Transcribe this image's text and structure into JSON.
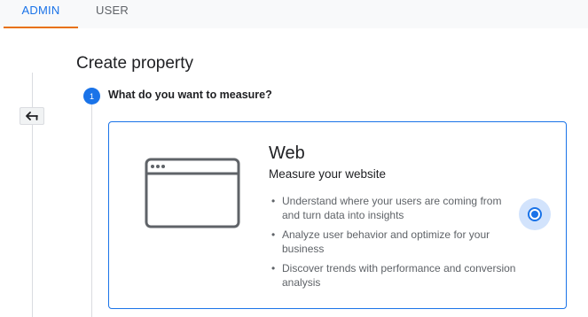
{
  "tabs": {
    "admin": "ADMIN",
    "user": "USER",
    "active": "admin"
  },
  "header": {
    "title": "Create property"
  },
  "step": {
    "number": "1",
    "question": "What do you want to measure?"
  },
  "option": {
    "title": "Web",
    "subtitle": "Measure your website",
    "bullets": [
      "Understand where your users are coming from and turn data into insights",
      "Analyze user behavior and optimize for your business",
      "Discover trends with performance and conversion analysis"
    ],
    "selected": true,
    "icon": "browser-window-icon"
  },
  "icons": {
    "back": "back-arrow-icon"
  },
  "colors": {
    "accent": "#1a73e8",
    "tab_underline": "#e8710a",
    "radio_halo": "#d2e3fc",
    "muted_text": "#5f6368"
  }
}
